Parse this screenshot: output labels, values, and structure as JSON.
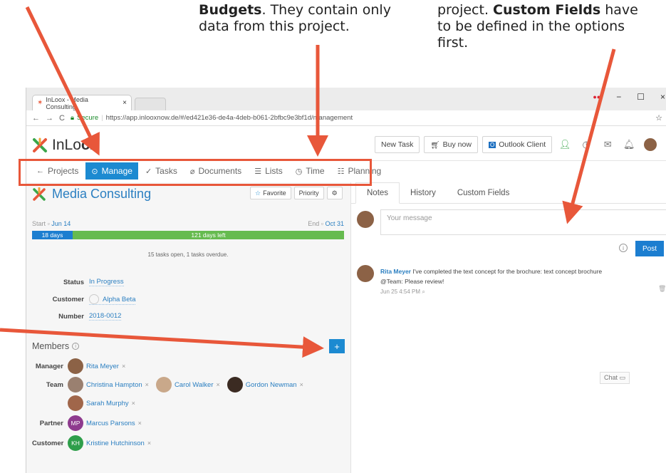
{
  "annotations": {
    "mid_bold": "Budgets",
    "mid_rest": ". They contain only",
    "mid_line2": "data from this project.",
    "right_line1_pre": "project. ",
    "right_line1_bold": "Custom Fields",
    "right_line1_post": " have",
    "right_line2": "to be defined in the options",
    "right_line3": "first."
  },
  "browser": {
    "tab_title": "InLoox - Media Consulting",
    "tab_close": "×",
    "secure_label": "Secure",
    "url": "https://app.inlooxnow.de/#/ed421e36-de4a-4deb-b061-2bfbc9e3bf1d/management",
    "window_controls": [
      "−",
      "☐",
      "×"
    ],
    "star": "☆"
  },
  "app": {
    "brand_light": "InLo",
    "brand_bold": "ox",
    "header_buttons": {
      "new_task": "New Task",
      "buy_now": "Buy now",
      "outlook_client": "Outlook Client"
    }
  },
  "nav": {
    "items": [
      {
        "label": "Projects",
        "icon": "←"
      },
      {
        "label": "Manage",
        "icon": "⊙"
      },
      {
        "label": "Tasks",
        "icon": "✓"
      },
      {
        "label": "Documents",
        "icon": "⌀"
      },
      {
        "label": "Lists",
        "icon": "☰"
      },
      {
        "label": "Time",
        "icon": "◷"
      },
      {
        "label": "Planning",
        "icon": "☷"
      }
    ]
  },
  "project": {
    "title": "Media Consulting",
    "favorite": "Favorite",
    "priority": "Priority",
    "start_label": "Start",
    "start_date": "Jun 14",
    "end_label": "End",
    "end_date": "Oct 31",
    "elapsed": "18 days",
    "remaining": "121 days left",
    "elapsed_fraction": 0.13,
    "tasks_summary": "15 tasks open, 1 tasks overdue.",
    "fields": {
      "status_label": "Status",
      "status_value": "In Progress",
      "customer_label": "Customer",
      "customer_value": "Alpha Beta",
      "number_label": "Number",
      "number_value": "2018-0012"
    }
  },
  "members": {
    "heading": "Members",
    "add_button": "+",
    "rows": {
      "manager_label": "Manager",
      "manager": "Rita Meyer",
      "team_label": "Team",
      "team": [
        "Christina Hampton",
        "Carol Walker",
        "Gordon Newman",
        "Sarah Murphy"
      ],
      "partner_label": "Partner",
      "partner": "Marcus Parsons",
      "partner_initials": "MP",
      "customer_label": "Customer",
      "customer": "Kristine Hutchinson",
      "customer_initials": "KH"
    },
    "remove": "×"
  },
  "notes": {
    "tabs": [
      "Notes",
      "History",
      "Custom Fields"
    ],
    "placeholder": "Your message",
    "post": "Post",
    "comment_author": "Rita Meyer",
    "comment_text": "I've completed the text concept for the brochure: text concept brochure",
    "comment_text2": "@Team: Please review!",
    "comment_time": "Jun 25 4:54 PM"
  },
  "chat": "Chat",
  "colors": {
    "accent": "#1c8ad1",
    "annotation": "#e8573a",
    "progress_done": "#1c7ed0",
    "progress_left": "#66bb4f",
    "partner_avatar": "#8e3a8e",
    "customer_avatar": "#2e9e4a"
  }
}
